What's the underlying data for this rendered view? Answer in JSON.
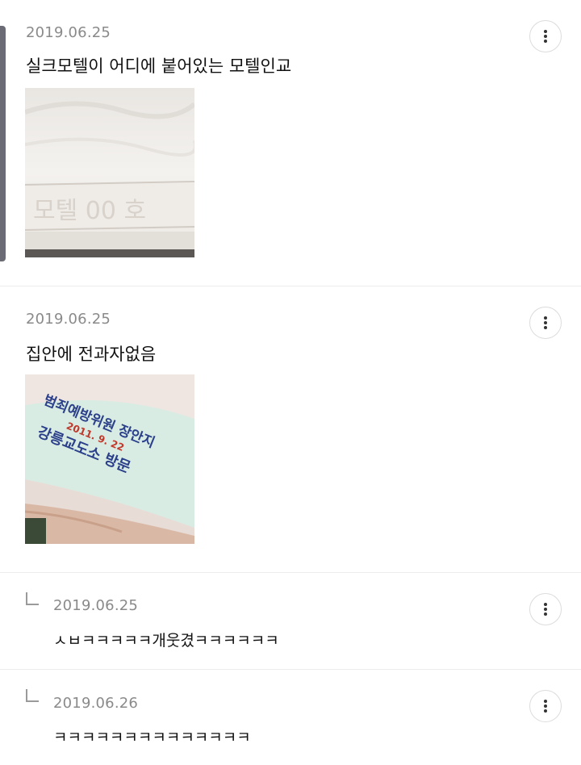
{
  "comments": [
    {
      "date": "2019.06.25",
      "text": "실크모텔이 어디에 붙어있는 모텔인교",
      "image": {
        "embossed_text": "모텔 00 호"
      }
    },
    {
      "date": "2019.06.25",
      "text": "집안에 전과자없음",
      "image": {
        "line1": "범죄예방위원 장안지",
        "line2_date": "2011. 9. 22",
        "line3": "강릉교도소 방문"
      }
    }
  ],
  "replies": [
    {
      "date": "2019.06.25",
      "text": "ㅅㅂㅋㅋㅋㅋㅋ개웃겼ㅋㅋㅋㅋㅋㅋ"
    },
    {
      "date": "2019.06.26",
      "text": "ㅋㅋㅋㅋㅋㅋㅋㅋㅋㅋㅋㅋㅋㅋ"
    }
  ],
  "icons": {
    "more": "more-vertical-icon",
    "reply": "reply-arrow-icon"
  },
  "colors": {
    "date": "#8a8a8a",
    "divider": "#ececec",
    "button_border": "#dcdcdc"
  }
}
